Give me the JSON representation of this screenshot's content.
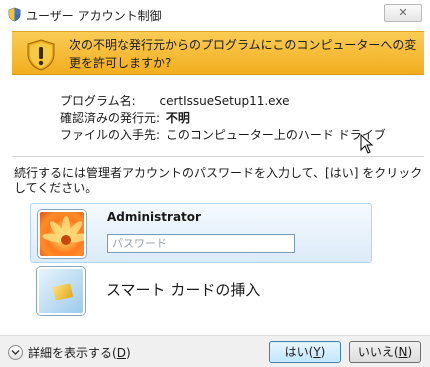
{
  "window": {
    "title": "ユーザー アカウント制御",
    "close_glyph": "✕",
    "shield_icon": "uac-shield-icon"
  },
  "banner": {
    "text": "次の不明な発行元からのプログラムにこのコンピューターへの変更を許可しますか?",
    "icon": "warning-shield-icon",
    "color": "#f5b83a"
  },
  "details": {
    "program_label": "プログラム名:",
    "program_value": "certIssueSetup11.exe",
    "publisher_label": "確認済みの発行元:",
    "publisher_value": "不明",
    "origin_label": "ファイルの入手先:",
    "origin_value": "このコンピューター上のハード ドライブ"
  },
  "instruction": "続行するには管理者アカウントのパスワードを入力して、[はい] をクリックしてください。",
  "admin_tile": {
    "name": "Administrator",
    "password_placeholder": "パスワード",
    "password_value": ""
  },
  "smartcard_tile": {
    "label": "スマート カードの挿入"
  },
  "footer": {
    "details_toggle": "詳細を表示する(",
    "details_key": "D",
    "yes_prefix": "はい(",
    "yes_key": "Y",
    "no_prefix": "いいえ(",
    "no_key": "N",
    "close_paren": ")"
  }
}
